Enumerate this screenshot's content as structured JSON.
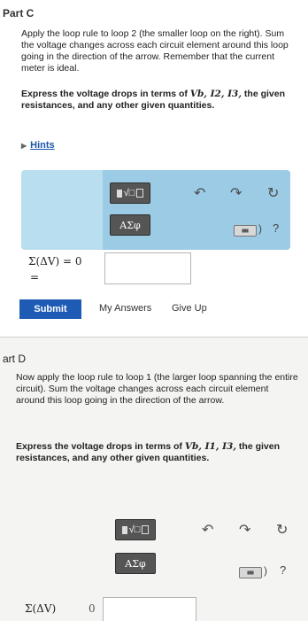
{
  "part_c": {
    "title": "Part C",
    "instructions": "Apply the loop rule to loop 2 (the smaller loop on the right). Sum the voltage changes across each circuit element around this loop going in the direction of the arrow. Remember that the current meter is ideal.",
    "express_prefix": "Express the voltage drops in terms of ",
    "express_vars": "Vb, I2, I3,",
    "express_suffix": " the given resistances, and any other given quantities.",
    "hints_label": "Hints",
    "equation_label": "Σ(ΔV) = 0",
    "equals_sign": "=",
    "submit_label": "Submit",
    "my_answers_label": "My Answers",
    "give_up_label": "Give Up"
  },
  "toolbar": {
    "template_label": "√□",
    "greek_label": "ΑΣφ",
    "undo_icon": "undo-icon",
    "redo_icon": "redo-icon",
    "reset_icon": "reset-icon",
    "keyboard_icon": "keyboard-icon",
    "help_label": "?",
    "paren_label": ")"
  },
  "part_d": {
    "title": "art D",
    "instructions": "Now apply the loop rule to loop 1 (the larger loop spanning the entire circuit). Sum the voltage changes across each circuit element around this loop going in the direction of the arrow.",
    "express_prefix": "Express the voltage drops in terms of ",
    "express_vars": "Vb, I1, I3,",
    "express_suffix": " the given resistances, and any other given quantities.",
    "equation_label": "Σ(ΔV)",
    "equation_value": "0"
  }
}
